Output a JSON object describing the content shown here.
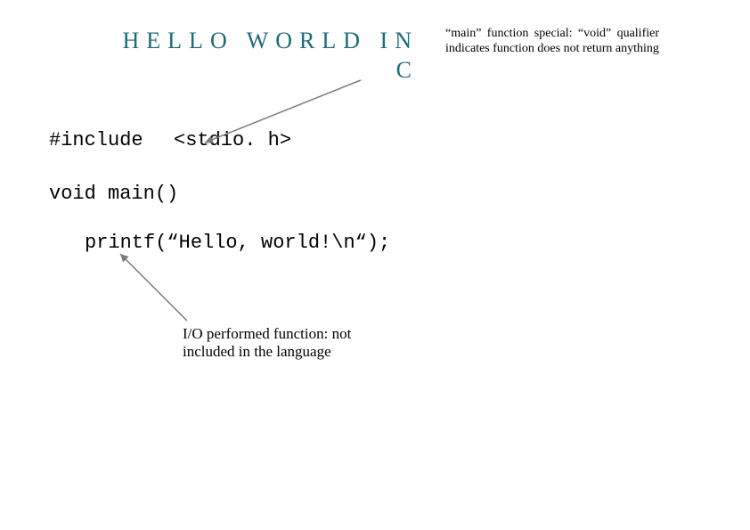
{
  "title": "HELLO WORLD IN C",
  "notes": {
    "main": "“main” function special: “void” qualifier indicates function does not return anything",
    "io": "I/O performed function: not included in the language"
  },
  "code": {
    "include": "#include",
    "include_header": "<stdio. h>",
    "void_main": "void main()",
    "printf": "printf(“Hello, world!\\n“);"
  }
}
